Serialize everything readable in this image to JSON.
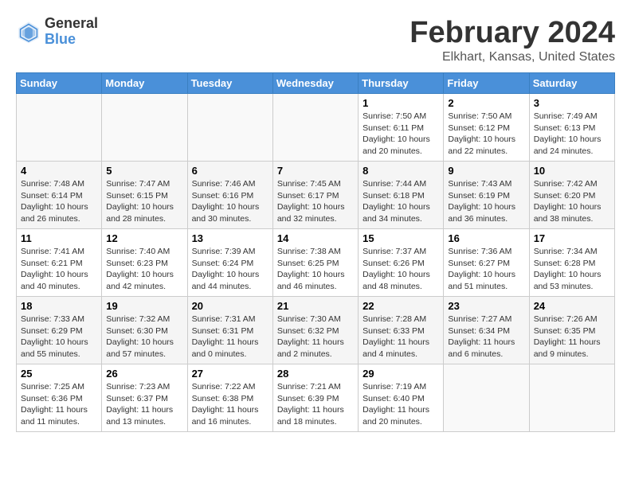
{
  "header": {
    "logo_general": "General",
    "logo_blue": "Blue",
    "title": "February 2024",
    "location": "Elkhart, Kansas, United States"
  },
  "days_of_week": [
    "Sunday",
    "Monday",
    "Tuesday",
    "Wednesday",
    "Thursday",
    "Friday",
    "Saturday"
  ],
  "weeks": [
    [
      {
        "day": "",
        "info": ""
      },
      {
        "day": "",
        "info": ""
      },
      {
        "day": "",
        "info": ""
      },
      {
        "day": "",
        "info": ""
      },
      {
        "day": "1",
        "info": "Sunrise: 7:50 AM\nSunset: 6:11 PM\nDaylight: 10 hours\nand 20 minutes."
      },
      {
        "day": "2",
        "info": "Sunrise: 7:50 AM\nSunset: 6:12 PM\nDaylight: 10 hours\nand 22 minutes."
      },
      {
        "day": "3",
        "info": "Sunrise: 7:49 AM\nSunset: 6:13 PM\nDaylight: 10 hours\nand 24 minutes."
      }
    ],
    [
      {
        "day": "4",
        "info": "Sunrise: 7:48 AM\nSunset: 6:14 PM\nDaylight: 10 hours\nand 26 minutes."
      },
      {
        "day": "5",
        "info": "Sunrise: 7:47 AM\nSunset: 6:15 PM\nDaylight: 10 hours\nand 28 minutes."
      },
      {
        "day": "6",
        "info": "Sunrise: 7:46 AM\nSunset: 6:16 PM\nDaylight: 10 hours\nand 30 minutes."
      },
      {
        "day": "7",
        "info": "Sunrise: 7:45 AM\nSunset: 6:17 PM\nDaylight: 10 hours\nand 32 minutes."
      },
      {
        "day": "8",
        "info": "Sunrise: 7:44 AM\nSunset: 6:18 PM\nDaylight: 10 hours\nand 34 minutes."
      },
      {
        "day": "9",
        "info": "Sunrise: 7:43 AM\nSunset: 6:19 PM\nDaylight: 10 hours\nand 36 minutes."
      },
      {
        "day": "10",
        "info": "Sunrise: 7:42 AM\nSunset: 6:20 PM\nDaylight: 10 hours\nand 38 minutes."
      }
    ],
    [
      {
        "day": "11",
        "info": "Sunrise: 7:41 AM\nSunset: 6:21 PM\nDaylight: 10 hours\nand 40 minutes."
      },
      {
        "day": "12",
        "info": "Sunrise: 7:40 AM\nSunset: 6:23 PM\nDaylight: 10 hours\nand 42 minutes."
      },
      {
        "day": "13",
        "info": "Sunrise: 7:39 AM\nSunset: 6:24 PM\nDaylight: 10 hours\nand 44 minutes."
      },
      {
        "day": "14",
        "info": "Sunrise: 7:38 AM\nSunset: 6:25 PM\nDaylight: 10 hours\nand 46 minutes."
      },
      {
        "day": "15",
        "info": "Sunrise: 7:37 AM\nSunset: 6:26 PM\nDaylight: 10 hours\nand 48 minutes."
      },
      {
        "day": "16",
        "info": "Sunrise: 7:36 AM\nSunset: 6:27 PM\nDaylight: 10 hours\nand 51 minutes."
      },
      {
        "day": "17",
        "info": "Sunrise: 7:34 AM\nSunset: 6:28 PM\nDaylight: 10 hours\nand 53 minutes."
      }
    ],
    [
      {
        "day": "18",
        "info": "Sunrise: 7:33 AM\nSunset: 6:29 PM\nDaylight: 10 hours\nand 55 minutes."
      },
      {
        "day": "19",
        "info": "Sunrise: 7:32 AM\nSunset: 6:30 PM\nDaylight: 10 hours\nand 57 minutes."
      },
      {
        "day": "20",
        "info": "Sunrise: 7:31 AM\nSunset: 6:31 PM\nDaylight: 11 hours\nand 0 minutes."
      },
      {
        "day": "21",
        "info": "Sunrise: 7:30 AM\nSunset: 6:32 PM\nDaylight: 11 hours\nand 2 minutes."
      },
      {
        "day": "22",
        "info": "Sunrise: 7:28 AM\nSunset: 6:33 PM\nDaylight: 11 hours\nand 4 minutes."
      },
      {
        "day": "23",
        "info": "Sunrise: 7:27 AM\nSunset: 6:34 PM\nDaylight: 11 hours\nand 6 minutes."
      },
      {
        "day": "24",
        "info": "Sunrise: 7:26 AM\nSunset: 6:35 PM\nDaylight: 11 hours\nand 9 minutes."
      }
    ],
    [
      {
        "day": "25",
        "info": "Sunrise: 7:25 AM\nSunset: 6:36 PM\nDaylight: 11 hours\nand 11 minutes."
      },
      {
        "day": "26",
        "info": "Sunrise: 7:23 AM\nSunset: 6:37 PM\nDaylight: 11 hours\nand 13 minutes."
      },
      {
        "day": "27",
        "info": "Sunrise: 7:22 AM\nSunset: 6:38 PM\nDaylight: 11 hours\nand 16 minutes."
      },
      {
        "day": "28",
        "info": "Sunrise: 7:21 AM\nSunset: 6:39 PM\nDaylight: 11 hours\nand 18 minutes."
      },
      {
        "day": "29",
        "info": "Sunrise: 7:19 AM\nSunset: 6:40 PM\nDaylight: 11 hours\nand 20 minutes."
      },
      {
        "day": "",
        "info": ""
      },
      {
        "day": "",
        "info": ""
      }
    ]
  ]
}
